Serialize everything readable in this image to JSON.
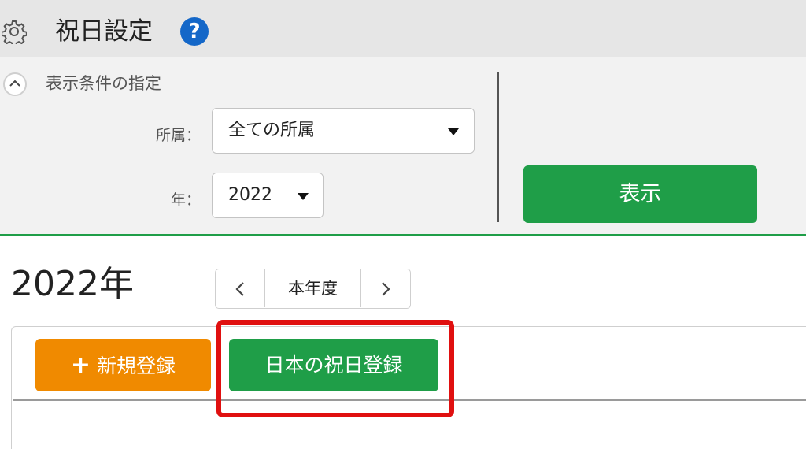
{
  "header": {
    "title": "祝日設定",
    "help_label": "?"
  },
  "filter": {
    "title": "表示条件の指定",
    "affiliation_label": "所属：",
    "affiliation_value": "全ての所属",
    "year_label": "年：",
    "year_value": "2022",
    "show_button": "表示"
  },
  "calendar": {
    "year_title": "2022年",
    "current_label": "本年度"
  },
  "actions": {
    "new_label": "新規登録",
    "new_icon": "+",
    "japan_holiday_label": "日本の祝日登録"
  },
  "colors": {
    "primary_green": "#1f9e48",
    "orange": "#f08a00",
    "highlight_red": "#e01010",
    "help_blue": "#1467c8"
  }
}
